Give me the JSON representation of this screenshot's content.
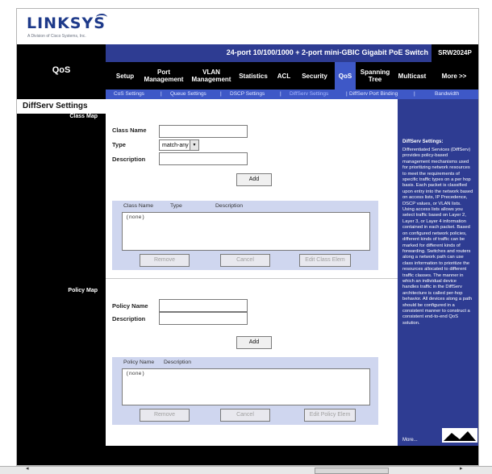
{
  "brand": {
    "logo": "LINKSYS",
    "tagline": "A Division of Cisco Systems, Inc."
  },
  "header": {
    "product_name": "24-port 10/100/1000 + 2-port mini-GBIC Gigabit PoE Switch",
    "model": "SRW2024P",
    "section_title": "QoS"
  },
  "nav": {
    "tabs": [
      {
        "label": "Setup"
      },
      {
        "label": "Port Management"
      },
      {
        "label": "VLAN Management"
      },
      {
        "label": "Statistics"
      },
      {
        "label": "ACL"
      },
      {
        "label": "Security"
      },
      {
        "label": "QoS"
      },
      {
        "label": "Spanning Tree"
      },
      {
        "label": "Multicast"
      },
      {
        "label": "More >>"
      }
    ],
    "active_tab": "QoS"
  },
  "subnav": {
    "items": [
      {
        "label": "CoS Settings"
      },
      {
        "label": "Queue Settings"
      },
      {
        "label": "DSCP Settings"
      },
      {
        "label": "DiffServ Settings"
      },
      {
        "label": "DiffServ Port Binding"
      },
      {
        "label": "Bandwidth"
      }
    ],
    "separator": "|"
  },
  "page": {
    "title": "DiffServ Settings"
  },
  "class_map": {
    "section_label": "Class Map",
    "class_name_label": "Class Name",
    "class_name_value": "",
    "type_label": "Type",
    "type_value": "match-any",
    "description_label": "Description",
    "description_value": "",
    "add_button": "Add",
    "columns": [
      "Class Name",
      "Type",
      "Description"
    ],
    "list_items": [
      "(none)"
    ],
    "remove_button": "Remove",
    "cancel_button": "Cancel",
    "edit_button": "Edit Class Elem"
  },
  "policy_map": {
    "section_label": "Policy Map",
    "policy_name_label": "Policy Name",
    "policy_name_value": "",
    "description_label": "Description",
    "description_value": "",
    "add_button": "Add",
    "columns": [
      "Policy Name",
      "Description"
    ],
    "list_items": [
      "(none)"
    ],
    "remove_button": "Remove",
    "cancel_button": "Cancel",
    "edit_button": "Edit Policy Elem"
  },
  "help": {
    "title": "DiffServ Settings:",
    "body": "Differentiated Services (DiffServ) provides policy-based management mechanisms used for prioritizing network resources to meet the requirements of specific traffic types on a per hop basis. Each packet is classified upon entry into the network based on access lists, IP Precedence, DSCP values, or VLAN lists. Using access lists allows you select traffic based on Layer 2, Layer 3, or Layer 4 information contained in each packet. Based on configured network policies, different kinds of traffic can be marked for different kinds of forwarding. Switches and routers along a network path can use class information to prioritize the resources allocated to different traffic classes. The manner in which an individual device handles traffic in the DiffServ architecture is called per-hop behavior. All devices along a path should be configured in a consistent manner to construct a consistent end-to-end QoS solution.",
    "more_link": "More..."
  },
  "colors": {
    "blue_bar": "#2e3c92",
    "active_blue": "#3e58c7",
    "panel_bg": "#cfd6ef",
    "black": "#000000"
  }
}
